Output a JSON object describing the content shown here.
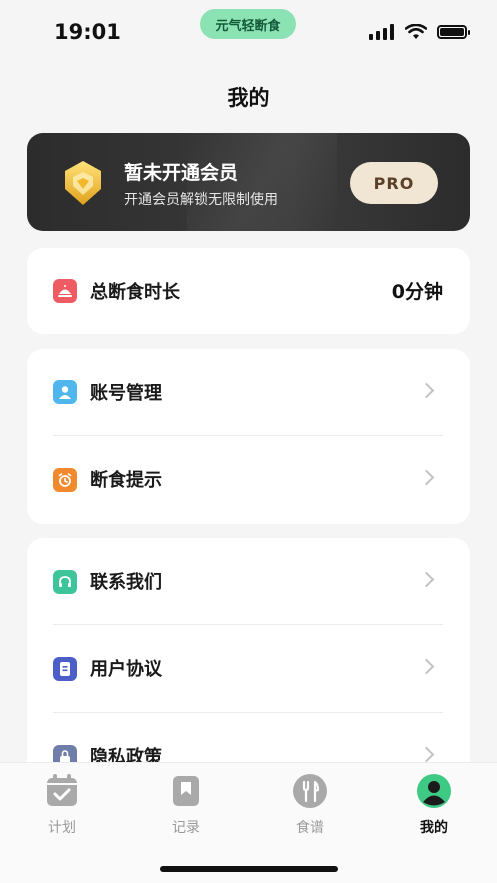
{
  "status_bar": {
    "time": "19:01",
    "app_pill": "元气轻断食"
  },
  "page": {
    "title": "我的"
  },
  "vip": {
    "title": "暂未开通会员",
    "subtitle": "开通会员解锁无限制使用",
    "button": "PRO"
  },
  "stats": {
    "label": "总断食时长",
    "value": "0分钟",
    "icon": "meal-cover-icon",
    "color": "#ef5b62"
  },
  "settings": [
    {
      "label": "账号管理",
      "icon": "user-icon",
      "color": "#4fb6ee"
    },
    {
      "label": "断食提示",
      "icon": "alarm-clock-icon",
      "color": "#f28a2d"
    }
  ],
  "info": [
    {
      "label": "联系我们",
      "icon": "headset-icon",
      "color": "#3ec49a"
    },
    {
      "label": "用户协议",
      "icon": "document-icon",
      "color": "#4b5fc8"
    },
    {
      "label": "隐私政策",
      "icon": "lock-icon",
      "color": "#6f7ea8"
    }
  ],
  "tabs": [
    {
      "label": "计划",
      "icon": "calendar-check-icon",
      "active": false
    },
    {
      "label": "记录",
      "icon": "bookmark-icon",
      "active": false
    },
    {
      "label": "食谱",
      "icon": "fork-knife-icon",
      "active": false
    },
    {
      "label": "我的",
      "icon": "profile-icon",
      "active": true
    }
  ],
  "colors": {
    "accent": "#8be3b4",
    "active_tab": "#3ec985"
  }
}
